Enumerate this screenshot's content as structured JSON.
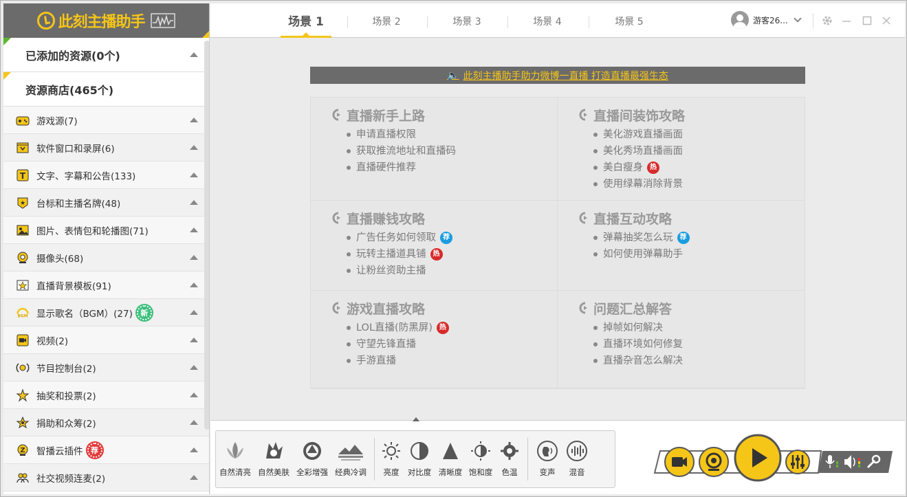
{
  "app": {
    "logo_text": "此刻主播助手"
  },
  "sidebar": {
    "added": {
      "label": "已添加的资源(0个)"
    },
    "store": {
      "label": "资源商店(465个)"
    },
    "categories": [
      {
        "label": "游戏源(7)",
        "icon": "gamepad-icon"
      },
      {
        "label": "软件窗口和录屏(6)",
        "icon": "window-capture-icon"
      },
      {
        "label": "文字、字幕和公告(133)",
        "icon": "text-icon"
      },
      {
        "label": "台标和主播名牌(48)",
        "icon": "badge-star-icon"
      },
      {
        "label": "图片、表情包和轮播图(71)",
        "icon": "image-icon"
      },
      {
        "label": "摄像头(68)",
        "icon": "webcam-icon"
      },
      {
        "label": "直播背景模板(91)",
        "icon": "template-icon"
      },
      {
        "label": "显示歌名（BGM）(27)",
        "icon": "bgm-icon",
        "badge": "新"
      },
      {
        "label": "视频(2)",
        "icon": "video-icon"
      },
      {
        "label": "节目控制台(2)",
        "icon": "console-icon"
      },
      {
        "label": "抽奖和投票(2)",
        "icon": "lottery-icon"
      },
      {
        "label": "捐助和众筹(2)",
        "icon": "donate-icon"
      },
      {
        "label": "智播云插件",
        "icon": "cloud-plugin-icon",
        "badge": "荐"
      },
      {
        "label": "社交视频连麦(2)",
        "icon": "social-icon"
      }
    ]
  },
  "tabs": [
    {
      "label": "场景 1",
      "active": true
    },
    {
      "label": "场景 2"
    },
    {
      "label": "场景 3"
    },
    {
      "label": "场景 4"
    },
    {
      "label": "场景 5"
    }
  ],
  "user": {
    "name": "游客26..."
  },
  "notice": {
    "text": "此刻主播助手助力微博一直播 打造直播最强生态"
  },
  "guides": [
    {
      "title": "直播新手上路",
      "items": [
        {
          "text": "申请直播权限"
        },
        {
          "text": "获取推流地址和直播码"
        },
        {
          "text": "直播硬件推荐"
        }
      ]
    },
    {
      "title": "直播间装饰攻略",
      "items": [
        {
          "text": "美化游戏直播画面"
        },
        {
          "text": "美化秀场直播画面"
        },
        {
          "text": "美白瘦身",
          "tag": "hot"
        },
        {
          "text": "使用绿幕消除背景"
        }
      ]
    },
    {
      "title": "直播赚钱攻略",
      "items": [
        {
          "text": "广告任务如何领取",
          "tag": "rec"
        },
        {
          "text": "玩转主播道具铺",
          "tag": "hot"
        },
        {
          "text": "让粉丝资助主播"
        }
      ]
    },
    {
      "title": "直播互动攻略",
      "items": [
        {
          "text": "弹幕抽奖怎么玩",
          "tag": "rec"
        },
        {
          "text": "如何使用弹幕助手"
        }
      ]
    },
    {
      "title": "游戏直播攻略",
      "items": [
        {
          "text": "LOL直播(防黑屏)",
          "tag": "hot"
        },
        {
          "text": "守望先锋直播"
        },
        {
          "text": "手游直播"
        }
      ]
    },
    {
      "title": "问题汇总解答",
      "items": [
        {
          "text": "掉帧如何解决"
        },
        {
          "text": "直播环境如何修复"
        },
        {
          "text": "直播杂音怎么解决"
        }
      ]
    }
  ],
  "tags": {
    "hot": "热",
    "rec": "荐"
  },
  "effects": [
    {
      "label": "自然清亮",
      "icon": "lotus-icon"
    },
    {
      "label": "自然美肤",
      "icon": "skin-icon"
    },
    {
      "label": "全彩增强",
      "icon": "aperture-icon"
    },
    {
      "label": "经典冷调",
      "icon": "landscape-icon"
    },
    {
      "label": "亮度",
      "icon": "sun-icon"
    },
    {
      "label": "对比度",
      "icon": "contrast-icon"
    },
    {
      "label": "清晰度",
      "icon": "sharpness-icon"
    },
    {
      "label": "饱和度",
      "icon": "saturation-icon"
    },
    {
      "label": "色温",
      "icon": "temperature-icon"
    },
    {
      "label": "变声",
      "icon": "voice-change-icon"
    },
    {
      "label": "混音",
      "icon": "mix-icon"
    }
  ],
  "colors": {
    "accent": "#f5c518",
    "header": "#6b6b6b",
    "hot": "#d72a2a",
    "rec": "#1a9ce0",
    "new": "#3cbf7c"
  }
}
